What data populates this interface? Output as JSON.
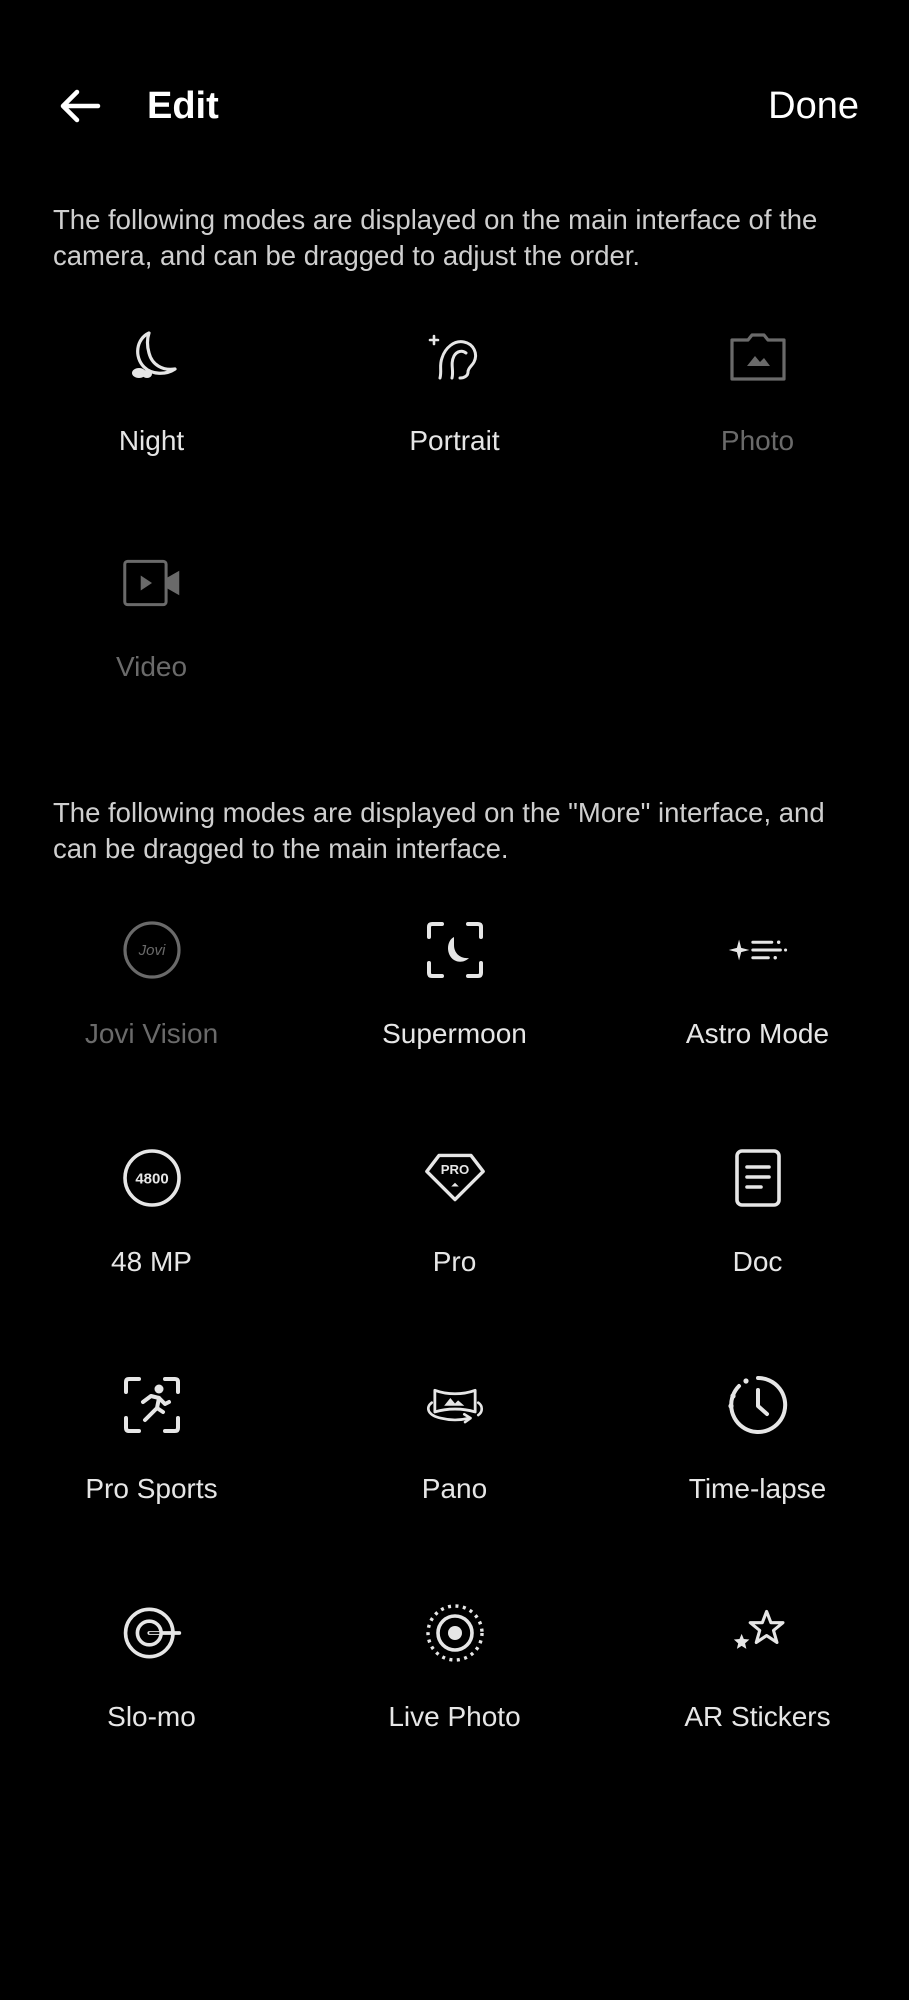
{
  "header": {
    "title": "Edit",
    "done_label": "Done",
    "back_icon": "arrow-left-icon"
  },
  "main_section": {
    "description": "The following modes are displayed on the main interface of the camera, and can be dragged to adjust the order.",
    "description_lines": [
      "The following modes are displayed on the main interface of the",
      "camera, and can be dragged to adjust the order."
    ],
    "modes": [
      {
        "label": "Night",
        "icon": "moon-icon",
        "dimmed": false
      },
      {
        "label": "Portrait",
        "icon": "portrait-icon",
        "dimmed": false
      },
      {
        "label": "Photo",
        "icon": "photo-icon",
        "dimmed": true
      },
      {
        "label": "Video",
        "icon": "video-icon",
        "dimmed": true
      }
    ]
  },
  "more_section": {
    "description": "The following modes are displayed on the \"More\" interface, and can be dragged to the main interface.",
    "description_lines": [
      "The following modes are displayed on the \"More\" interface, and",
      "can be dragged to the main interface."
    ],
    "modes": [
      {
        "label": "Jovi Vision",
        "icon": "jovi-vision-icon",
        "icon_text": "Jovi",
        "dimmed": true
      },
      {
        "label": "Supermoon",
        "icon": "supermoon-icon",
        "dimmed": false
      },
      {
        "label": "Astro Mode",
        "icon": "astro-icon",
        "dimmed": false
      },
      {
        "label": "48 MP",
        "icon": "48mp-icon",
        "icon_text": "4800",
        "dimmed": false
      },
      {
        "label": "Pro",
        "icon": "pro-icon",
        "icon_text": "PRO",
        "dimmed": false
      },
      {
        "label": "Doc",
        "icon": "doc-icon",
        "dimmed": false
      },
      {
        "label": "Pro Sports",
        "icon": "pro-sports-icon",
        "dimmed": false
      },
      {
        "label": "Pano",
        "icon": "pano-icon",
        "dimmed": false
      },
      {
        "label": "Time-lapse",
        "icon": "time-lapse-icon",
        "dimmed": false
      },
      {
        "label": "Slo-mo",
        "icon": "slo-mo-icon",
        "dimmed": false
      },
      {
        "label": "Live Photo",
        "icon": "live-photo-icon",
        "dimmed": false
      },
      {
        "label": "AR Stickers",
        "icon": "ar-stickers-icon",
        "dimmed": false
      }
    ]
  },
  "colors": {
    "background": "#000000",
    "text_primary": "#ffffff",
    "text_secondary": "#cfcfcf",
    "icon_active": "#e6e6e6",
    "icon_dimmed": "#6a6a6a"
  }
}
